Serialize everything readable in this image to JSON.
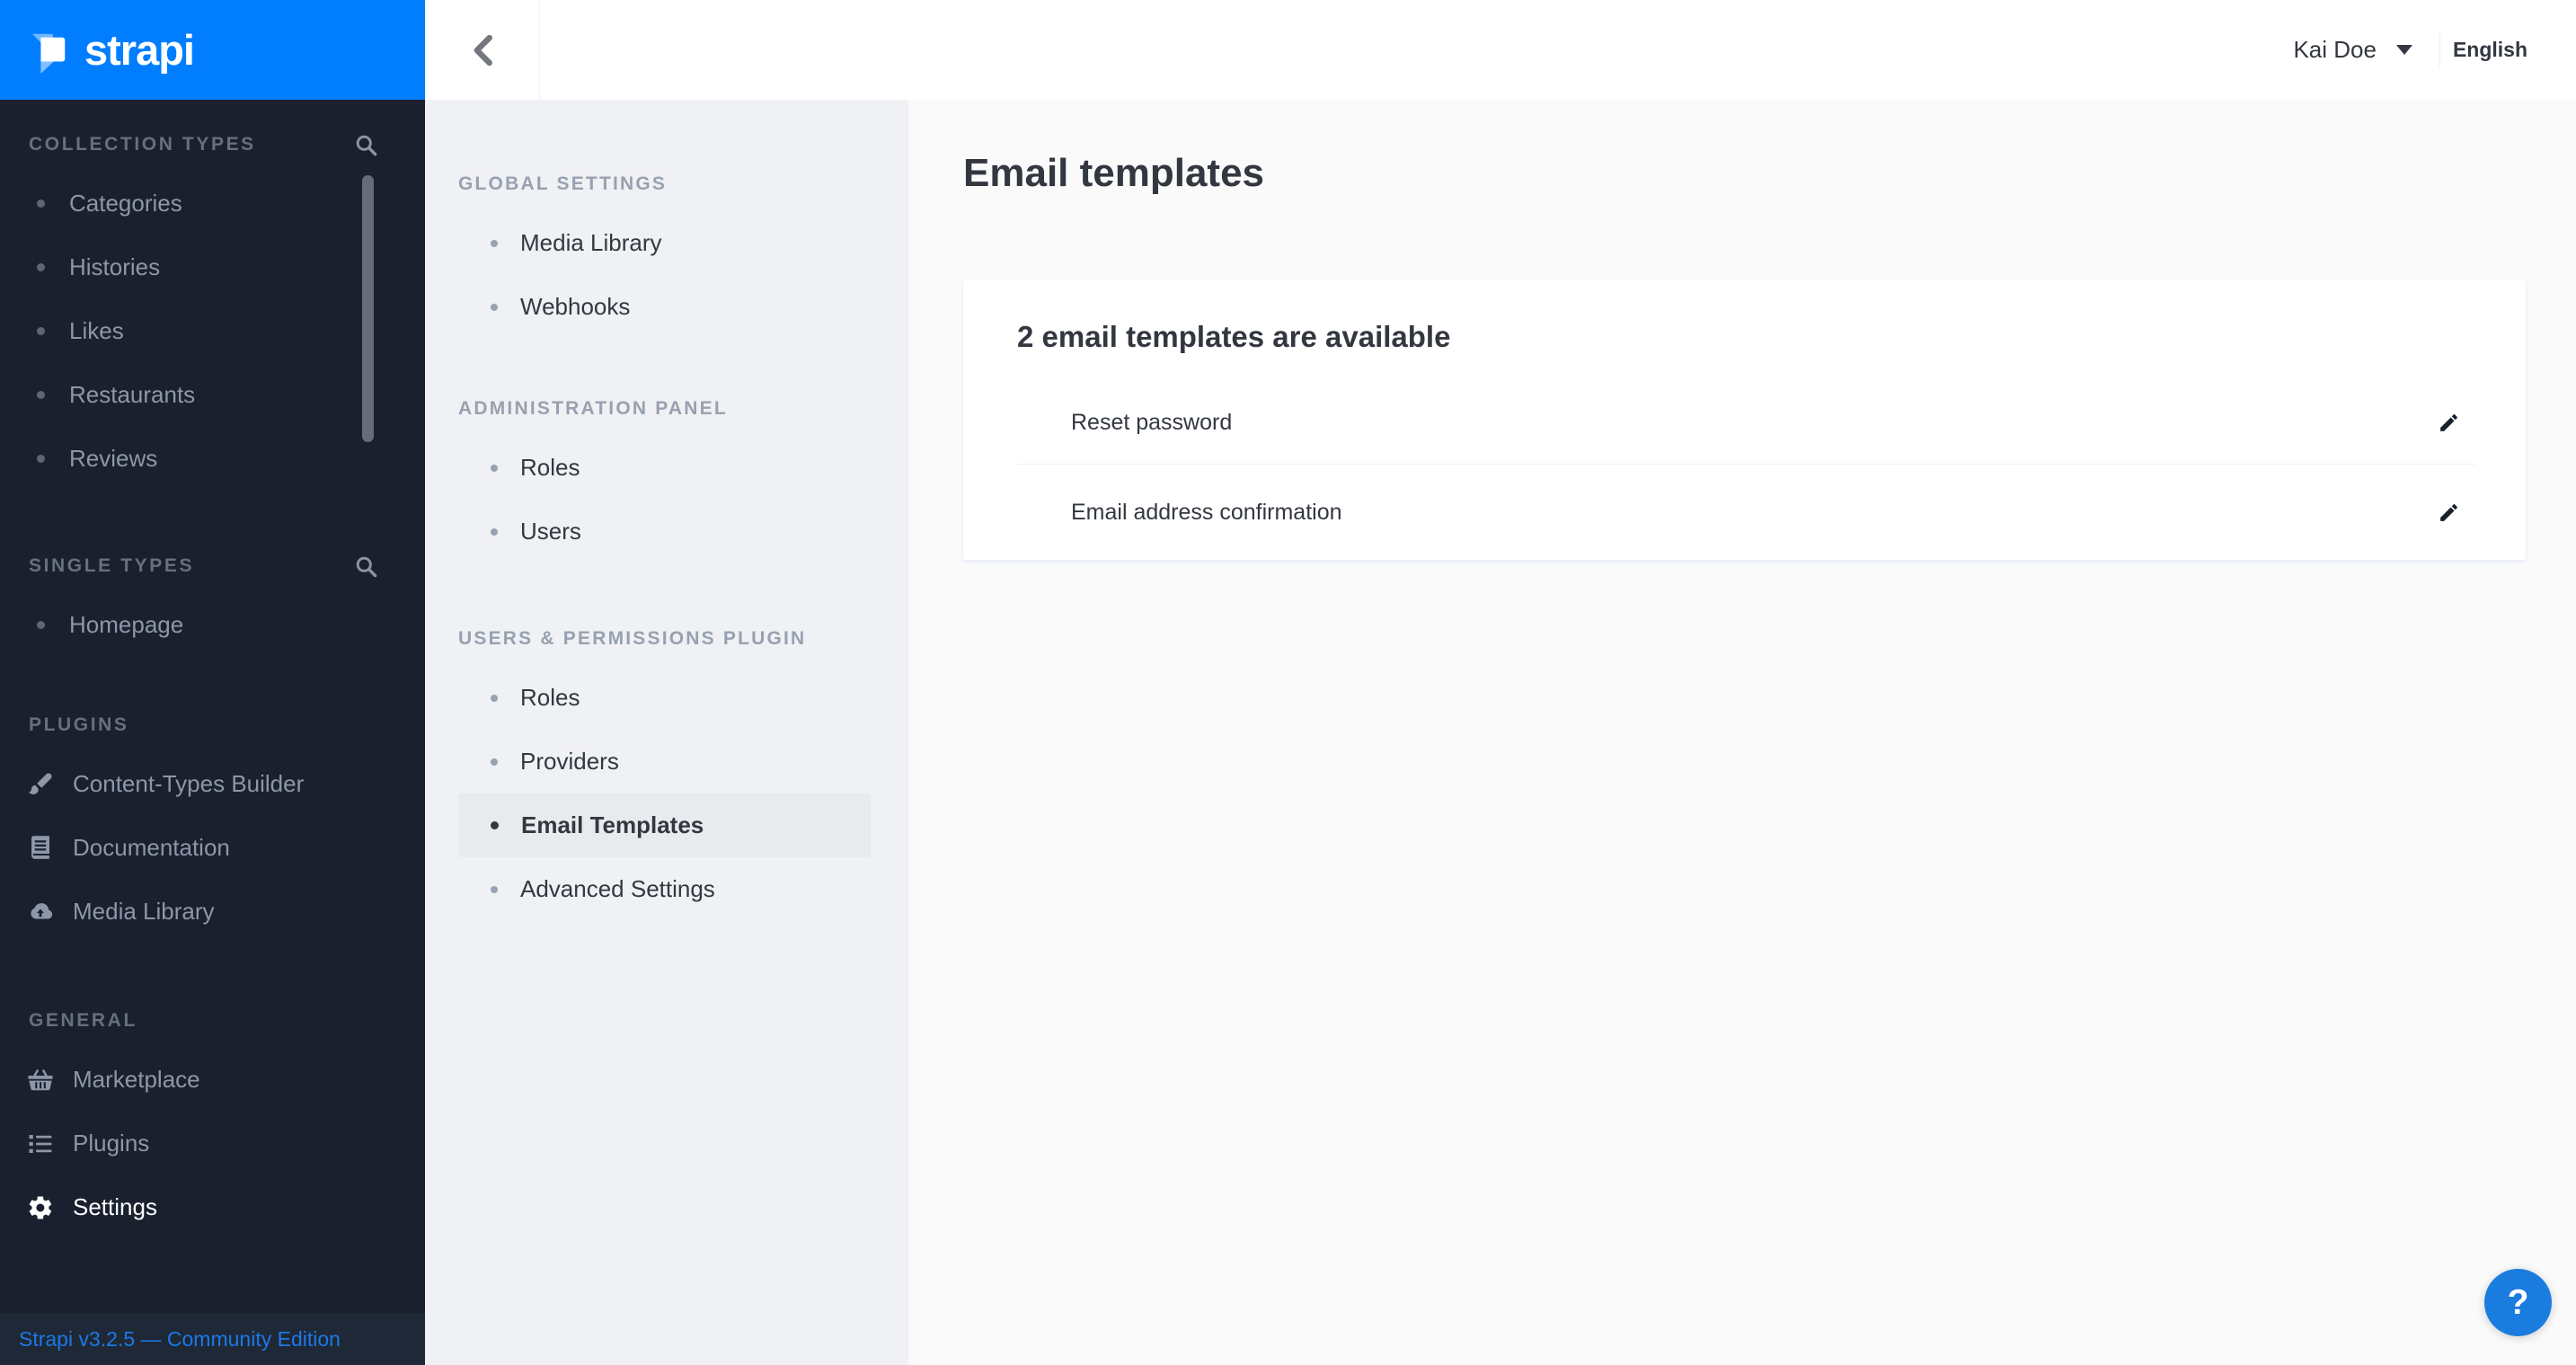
{
  "brand": {
    "logo_text": "strapi",
    "primary_color": "#007eff",
    "help_button_color": "#1b7cdf",
    "footer_link_color": "#1c78e8"
  },
  "main_sidebar": {
    "sections": [
      {
        "label": "COLLECTION TYPES",
        "has_search": true,
        "items": [
          {
            "label": "Categories"
          },
          {
            "label": "Histories"
          },
          {
            "label": "Likes"
          },
          {
            "label": "Restaurants"
          },
          {
            "label": "Reviews"
          }
        ]
      },
      {
        "label": "SINGLE TYPES",
        "has_search": true,
        "items": [
          {
            "label": "Homepage"
          }
        ]
      },
      {
        "label": "PLUGINS",
        "has_search": false,
        "items": [
          {
            "label": "Content-Types Builder",
            "icon": "paintbrush-icon"
          },
          {
            "label": "Documentation",
            "icon": "book-icon"
          },
          {
            "label": "Media Library",
            "icon": "cloud-upload-icon"
          }
        ]
      },
      {
        "label": "GENERAL",
        "has_search": false,
        "items": [
          {
            "label": "Marketplace",
            "icon": "basket-icon"
          },
          {
            "label": "Plugins",
            "icon": "list-icon"
          },
          {
            "label": "Settings",
            "icon": "gear-icon",
            "active": true
          }
        ]
      }
    ],
    "footer_version": "Strapi v3.2.5 — Community Edition"
  },
  "topbar": {
    "back_icon": "chevron-left-icon",
    "user_name": "Kai Doe",
    "language": "English"
  },
  "settings_nav": {
    "sections": [
      {
        "label": "GLOBAL SETTINGS",
        "items": [
          {
            "label": "Media Library"
          },
          {
            "label": "Webhooks"
          }
        ]
      },
      {
        "label": "ADMINISTRATION PANEL",
        "items": [
          {
            "label": "Roles"
          },
          {
            "label": "Users"
          }
        ]
      },
      {
        "label": "USERS & PERMISSIONS PLUGIN",
        "items": [
          {
            "label": "Roles"
          },
          {
            "label": "Providers"
          },
          {
            "label": "Email Templates",
            "active": true
          },
          {
            "label": "Advanced Settings"
          }
        ]
      }
    ]
  },
  "content": {
    "page_title": "Email templates",
    "card_title": "2 email templates are available",
    "templates": [
      {
        "name": "Reset password"
      },
      {
        "name": "Email address confirmation"
      }
    ],
    "help_label": "?"
  }
}
